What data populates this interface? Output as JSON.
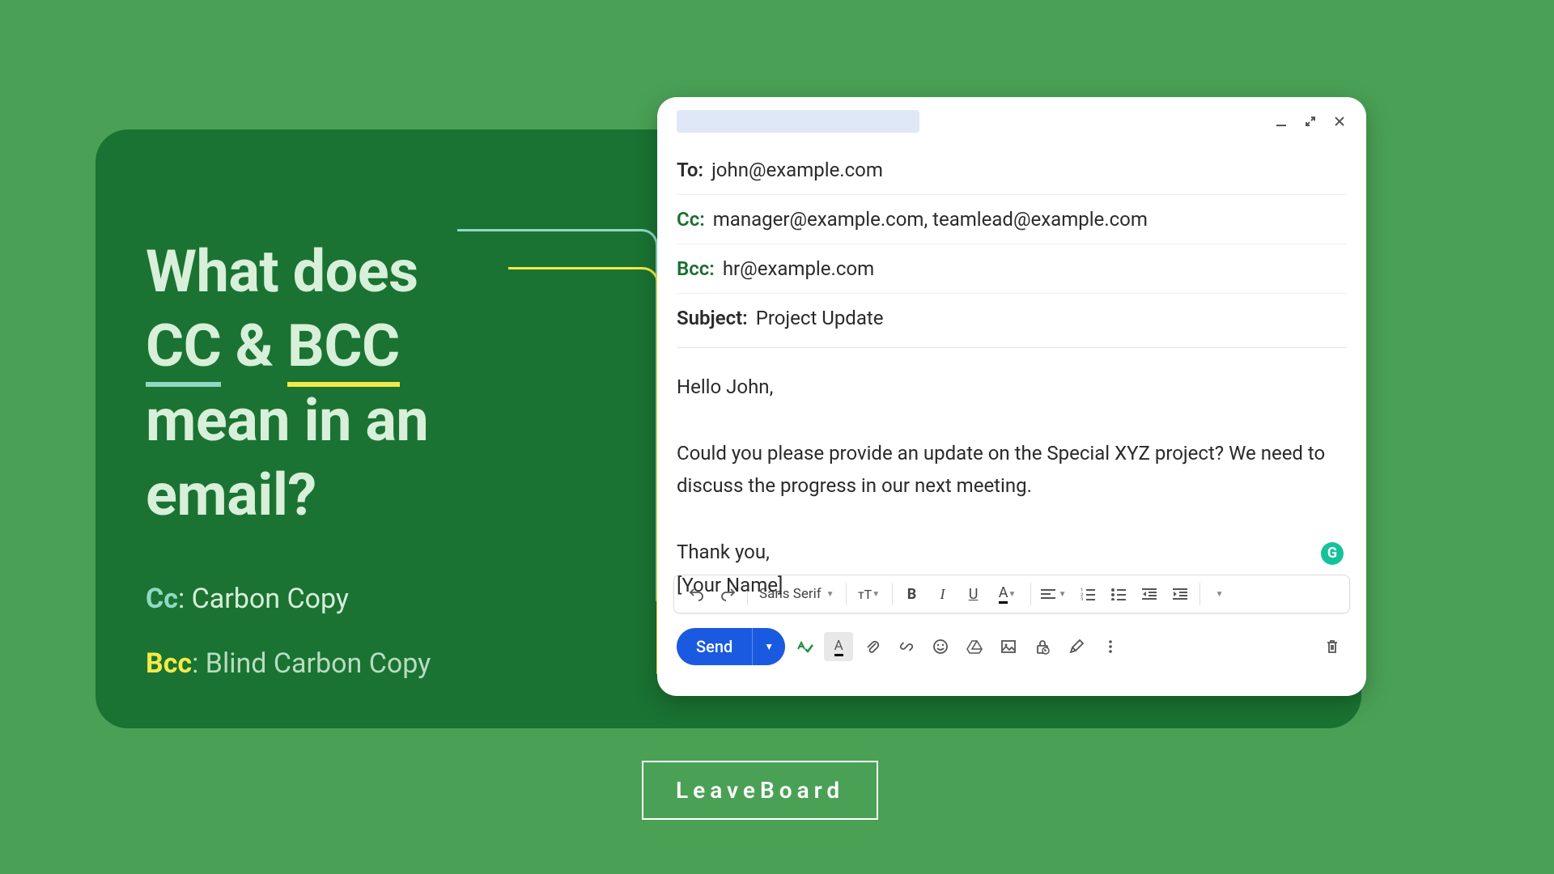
{
  "headline": {
    "line1": "What does",
    "cc": "CC",
    "amp": "&",
    "bcc": "BCC",
    "line3": "mean in an",
    "line4": "email?"
  },
  "definitions": {
    "cc_prefix": "Cc",
    "cc_text": ": Carbon Copy",
    "bcc_prefix": "Bcc",
    "bcc_text": ": Blind Carbon Copy"
  },
  "email": {
    "to_label": "To:",
    "to_value": "john@example.com",
    "cc_label": "Cc:",
    "cc_value": "manager@example.com, teamlead@example.com",
    "bcc_label": "Bcc:",
    "bcc_value": "hr@example.com",
    "subject_label": "Subject:",
    "subject_value": "Project Update",
    "body_greeting": "Hello John,",
    "body_para": "Could you please provide an update on the Special XYZ project? We need to discuss the progress in our next meeting.",
    "body_thanks": "Thank you,",
    "body_signature": "[Your Name]"
  },
  "toolbar": {
    "font_name": "Sans Serif",
    "send_label": "Send"
  },
  "brand": "LeaveBoard",
  "icons": {
    "grammarly": "G"
  }
}
